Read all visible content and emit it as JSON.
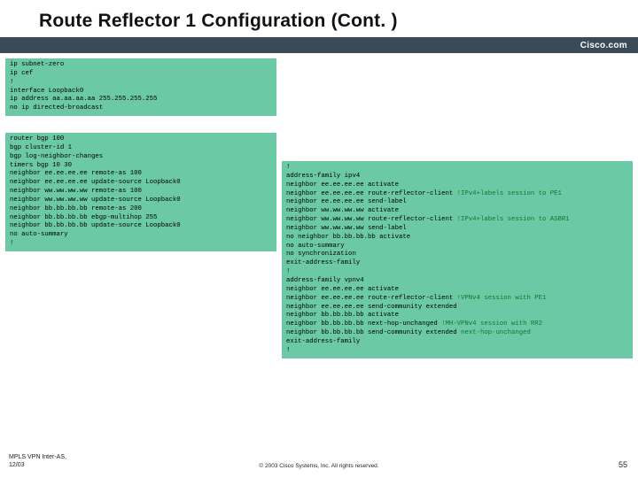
{
  "title": "Route Reflector 1 Configuration (Cont. )",
  "brand": "Cisco.com",
  "code": {
    "top": "ip subnet-zero\nip cef\n!\ninterface Loopback0\nip address aa.aa.aa.aa 255.255.255.255\nno ip directed-broadcast",
    "left": "router bgp 100\nbgp cluster-id 1\nbgp log-neighbor-changes\ntimers bgp 10 30\nneighbor ee.ee.ee.ee remote-as 100\nneighbor ee.ee.ee.ee update-source Loopback0\nneighbor ww.ww.ww.ww remote-as 100\nneighbor ww.ww.ww.ww update-source Loopback0\nneighbor bb.bb.bb.bb remote-as 200\nneighbor bb.bb.bb.bb ebgp-multihop 255\nneighbor bb.bb.bb.bb update-source Loopback0\nno auto-summary\n!",
    "right_lines": [
      {
        "t": "!",
        "c": false
      },
      {
        "t": "address-family ipv4",
        "c": false
      },
      {
        "t": "neighbor ee.ee.ee.ee activate",
        "c": false
      },
      {
        "t": "neighbor ee.ee.ee.ee route-reflector-client ",
        "c": false,
        "suffix": "!IPv4+labels session to PE1"
      },
      {
        "t": "neighbor ee.ee.ee.ee send-label",
        "c": false
      },
      {
        "t": "neighbor ww.ww.ww.ww activate",
        "c": false
      },
      {
        "t": "neighbor ww.ww.ww.ww route-reflector-client ",
        "c": false,
        "suffix": "!IPv4+labels session to ASBR1"
      },
      {
        "t": "neighbor ww.ww.ww.ww send-label",
        "c": false
      },
      {
        "t": "no neighbor bb.bb.bb.bb activate",
        "c": false
      },
      {
        "t": "no auto-summary",
        "c": false
      },
      {
        "t": "no synchronization",
        "c": false
      },
      {
        "t": "exit-address-family",
        "c": false
      },
      {
        "t": "!",
        "c": false
      },
      {
        "t": "address-family vpnv4",
        "c": false
      },
      {
        "t": "neighbor ee.ee.ee.ee activate",
        "c": false
      },
      {
        "t": "neighbor ee.ee.ee.ee route-reflector-client ",
        "c": false,
        "suffix": "!VPNv4 session with PE1"
      },
      {
        "t": "neighbor ee.ee.ee.ee send-community extended",
        "c": false
      },
      {
        "t": "neighbor bb.bb.bb.bb activate",
        "c": false
      },
      {
        "t": "neighbor bb.bb.bb.bb next-hop-unchanged ",
        "c": false,
        "suffix": "!MH-VPNv4 session with RR2"
      },
      {
        "t": "neighbor bb.bb.bb.bb send-community extended ",
        "c": false,
        "suffix": "next-hop-unchanged"
      },
      {
        "t": "exit-address-family",
        "c": false
      },
      {
        "t": "!",
        "c": false
      }
    ]
  },
  "footer": {
    "left_line1": "MPLS VPN Inter-AS,",
    "left_line2": "12/03",
    "center": "© 2003 Cisco Systems, Inc. All rights reserved.",
    "right": "55"
  }
}
